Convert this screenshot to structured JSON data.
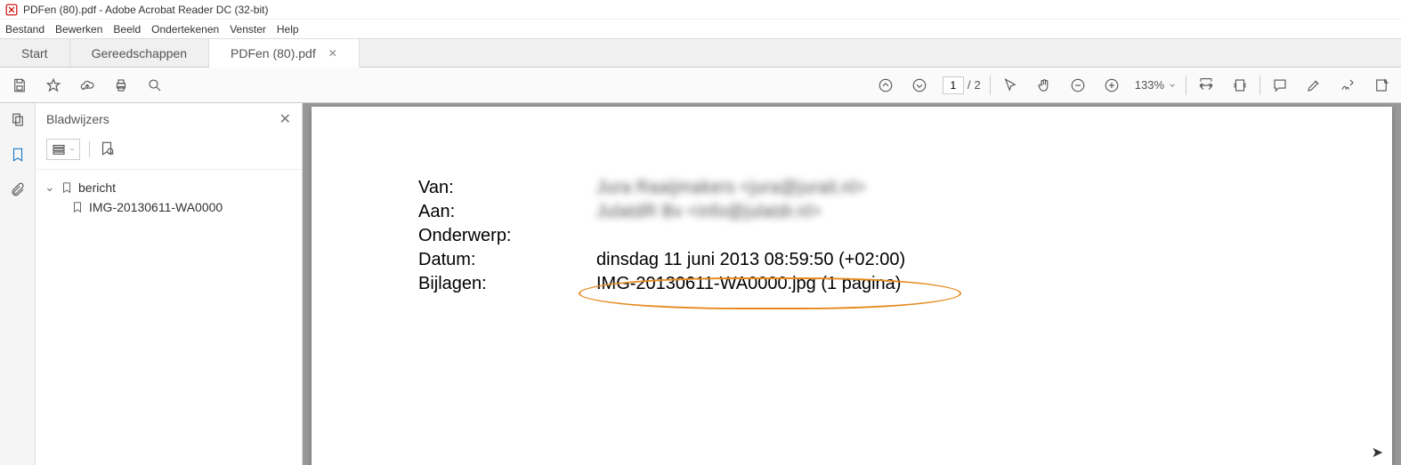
{
  "window": {
    "title": "PDFen (80).pdf - Adobe Acrobat Reader DC (32-bit)"
  },
  "menubar": {
    "items": [
      "Bestand",
      "Bewerken",
      "Beeld",
      "Ondertekenen",
      "Venster",
      "Help"
    ]
  },
  "tabs": {
    "start": "Start",
    "tools": "Gereedschappen",
    "file": "PDFen (80).pdf"
  },
  "toolbar": {
    "page_current": "1",
    "page_total": "2",
    "zoom": "133%"
  },
  "bookmarks": {
    "title": "Bladwijzers",
    "items": [
      {
        "label": "bericht",
        "children": [
          {
            "label": "IMG-20130611-WA0000"
          }
        ]
      }
    ]
  },
  "document": {
    "fields": {
      "van_label": "Van:",
      "van_value": "Jura Raaijmakers <jura@jurait.nl>",
      "aan_label": "Aan:",
      "aan_value": "JulatdR Bv <info@julatdr.nl>",
      "onderwerp_label": "Onderwerp:",
      "onderwerp_value": "",
      "datum_label": "Datum:",
      "datum_value": "dinsdag 11 juni 2013 08:59:50 (+02:00)",
      "bijlagen_label": "Bijlagen:",
      "bijlagen_value": "IMG-20130611-WA0000.jpg (1 pagina)"
    }
  }
}
